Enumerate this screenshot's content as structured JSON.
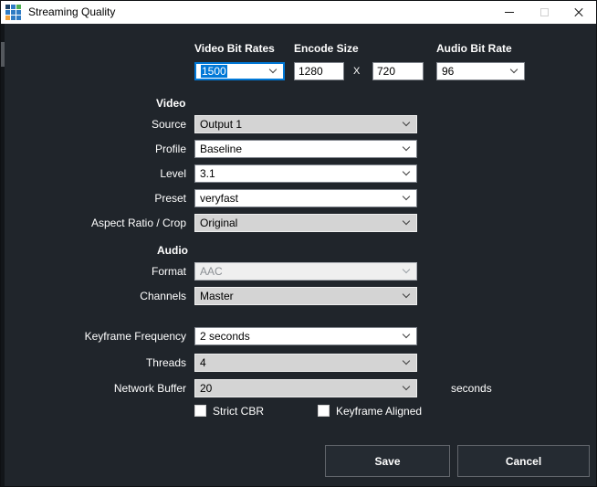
{
  "window": {
    "title": "Streaming Quality"
  },
  "icons": {
    "app": "grid-icon",
    "dropdown": "chevron-down-icon",
    "minimize": "minimize-icon",
    "maximize": "maximize-icon",
    "close": "close-icon"
  },
  "top_row": {
    "video_bit_rates": {
      "label": "Video Bit Rates",
      "value": "1500"
    },
    "encode_size": {
      "label": "Encode Size",
      "width": "1280",
      "separator": "X",
      "height": "720"
    },
    "audio_bit_rate": {
      "label": "Audio Bit Rate",
      "value": "96"
    }
  },
  "sections": {
    "video": {
      "heading": "Video",
      "rows": [
        {
          "label": "Source",
          "value": "Output 1",
          "style": "gray"
        },
        {
          "label": "Profile",
          "value": "Baseline",
          "style": "white"
        },
        {
          "label": "Level",
          "value": "3.1",
          "style": "white"
        },
        {
          "label": "Preset",
          "value": "veryfast",
          "style": "white"
        },
        {
          "label": "Aspect Ratio / Crop",
          "value": "Original",
          "style": "gray"
        }
      ]
    },
    "audio": {
      "heading": "Audio",
      "rows": [
        {
          "label": "Format",
          "value": "AAC",
          "style": "disabled"
        },
        {
          "label": "Channels",
          "value": "Master",
          "style": "gray"
        }
      ]
    },
    "advanced": {
      "rows": [
        {
          "label": "Keyframe Frequency",
          "value": "2 seconds",
          "style": "white",
          "suffix": ""
        },
        {
          "label": "Threads",
          "value": "4",
          "style": "gray",
          "suffix": ""
        },
        {
          "label": "Network Buffer",
          "value": "20",
          "style": "gray",
          "suffix": "seconds"
        }
      ]
    }
  },
  "checkboxes": [
    {
      "label": "Strict CBR",
      "checked": false
    },
    {
      "label": "Keyframe Aligned",
      "checked": false
    }
  ],
  "buttons": {
    "save": "Save",
    "cancel": "Cancel"
  },
  "colors": {
    "accent_blue": "#0078d7",
    "background": "#20252b",
    "titlebar": "#ffffff",
    "combo_gray": "#d4d4d4",
    "combo_white": "#ffffff",
    "combo_disabled": "#efefef",
    "button_bg": "#252b32",
    "button_border": "#62666c",
    "selection": "#0078d7"
  }
}
